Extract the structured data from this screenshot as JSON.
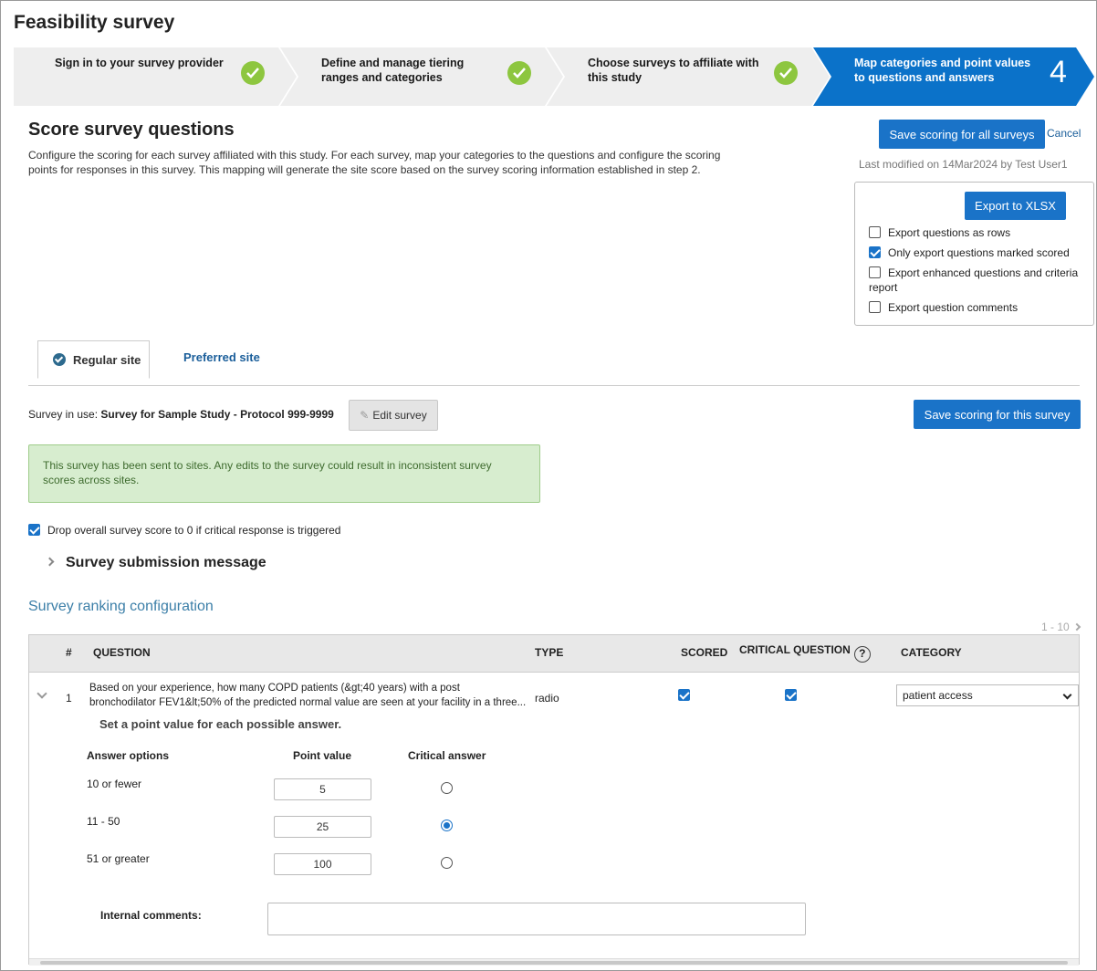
{
  "app_title": "Feasibility survey",
  "wizard": {
    "steps": [
      {
        "label": "Sign in to your survey provider",
        "status": "complete"
      },
      {
        "label": "Define and manage tiering ranges and categories",
        "status": "complete"
      },
      {
        "label": "Choose surveys to affiliate with this study",
        "status": "complete"
      },
      {
        "label": "Map categories and point values to questions and answers",
        "status": "active",
        "number": "4"
      }
    ],
    "complete_color": "#8dc63f",
    "active_color": "#0b72c9"
  },
  "section": {
    "title": "Score survey questions",
    "description": "Configure the scoring for each survey affiliated with this study. For each survey, map your categories to the questions and configure the scoring points for responses in this survey. This mapping will generate the site score based on the survey scoring information established in step 2."
  },
  "actions": {
    "save_all": "Save scoring for all surveys",
    "cancel": "Cancel",
    "last_modified": "Last modified on 14Mar2024 by Test User1"
  },
  "export": {
    "button": "Export to XLSX",
    "options": [
      {
        "label": "Export questions as rows",
        "checked": false
      },
      {
        "label": "Only export questions marked scored",
        "checked": true
      },
      {
        "label": "Export enhanced questions and criteria report",
        "checked": false
      },
      {
        "label": "Export question comments",
        "checked": false
      }
    ]
  },
  "tabs": [
    {
      "label": "Regular site",
      "active": true
    },
    {
      "label": "Preferred site",
      "active": false
    }
  ],
  "survey": {
    "in_use_label": "Survey in use:",
    "name": "Survey for Sample Study - Protocol 999-9999",
    "edit_button": "Edit survey",
    "save_button": "Save scoring for this survey"
  },
  "alert": {
    "text": "This survey has been sent to sites. Any edits to the survey could result in inconsistent survey scores across sites."
  },
  "drop_score": {
    "label": "Drop overall survey score to 0 if critical response is triggered",
    "checked": true
  },
  "submission_message": {
    "label": "Survey submission message"
  },
  "ranking": {
    "title": "Survey ranking configuration",
    "pager": "1 - 10",
    "columns": [
      "#",
      "QUESTION",
      "TYPE",
      "SCORED",
      "CRITICAL QUESTION",
      "CATEGORY"
    ],
    "rows": [
      {
        "number": "1",
        "question": "Based on your experience, how many COPD patients (&gt;40 years) with a post bronchodilator FEV1&lt;50% of the predicted normal value are seen at your facility in a three...",
        "type": "radio",
        "scored": true,
        "critical": true,
        "category": "patient access"
      }
    ]
  },
  "answers": {
    "title": "Set a point value for each possible answer.",
    "col_options": "Answer options",
    "col_points": "Point value",
    "col_critical": "Critical answer",
    "items": [
      {
        "option": "10 or fewer",
        "points": "5",
        "critical": false
      },
      {
        "option": "11 - 50",
        "points": "25",
        "critical": true
      },
      {
        "option": "51 or greater",
        "points": "100",
        "critical": false
      }
    ],
    "internal_comments_label": "Internal comments:",
    "internal_comments_value": ""
  }
}
